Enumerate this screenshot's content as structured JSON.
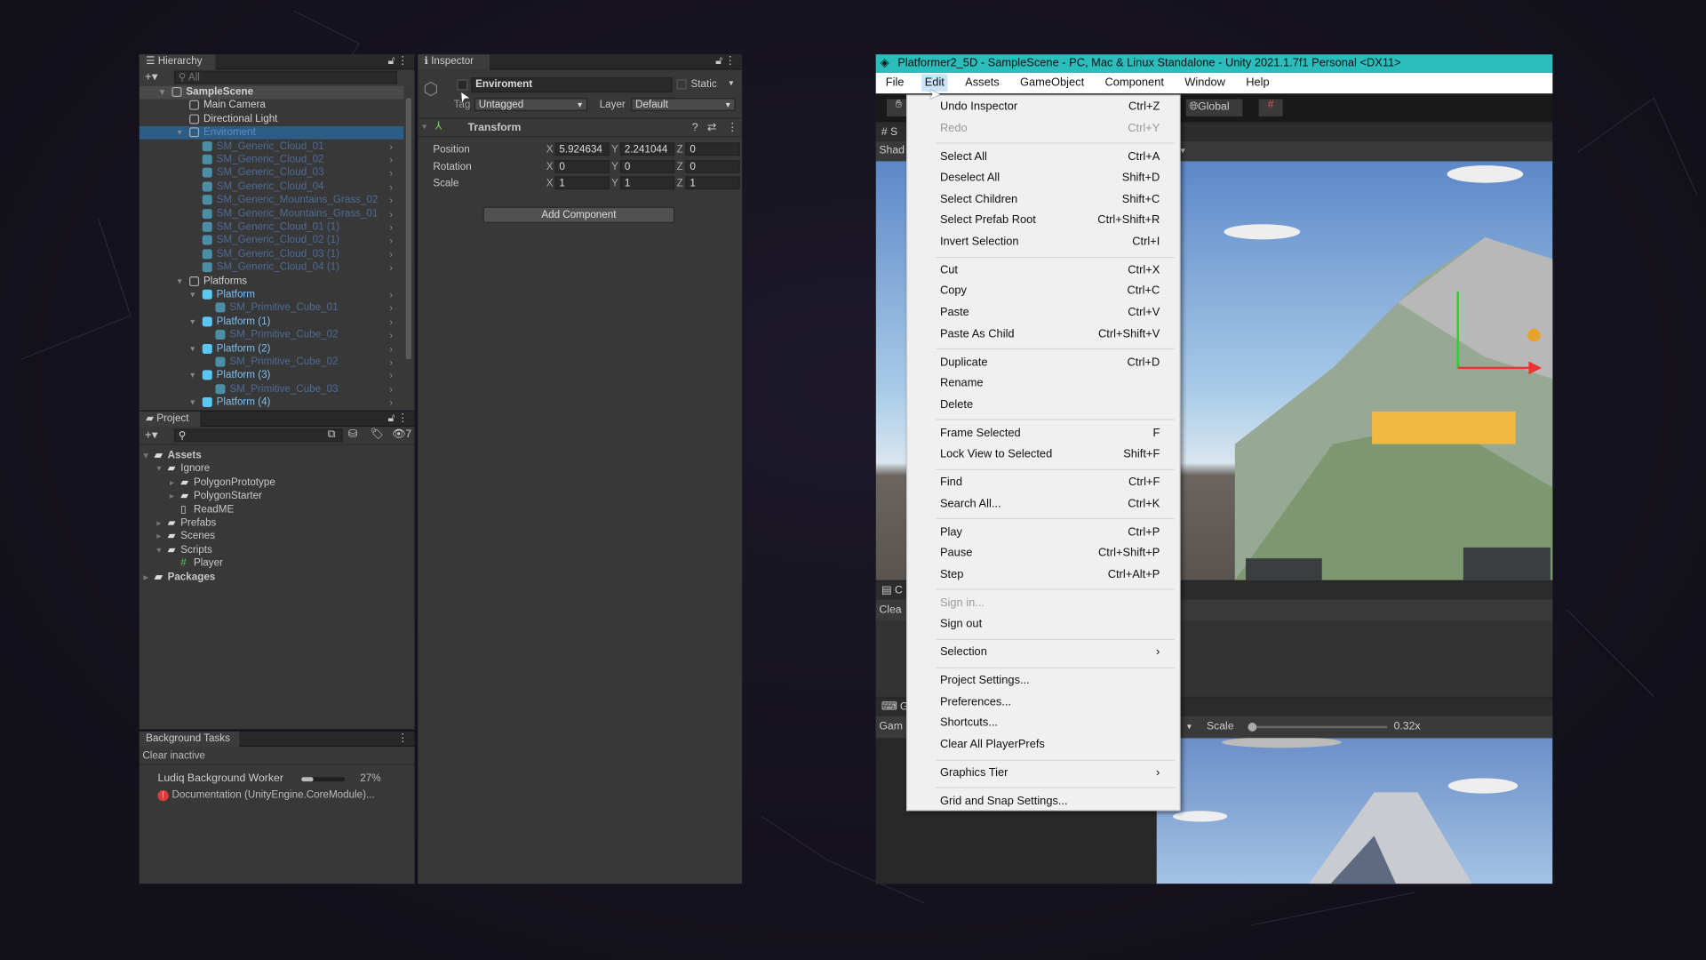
{
  "hierarchy": {
    "tab": "Hierarchy",
    "search_placeholder": "All",
    "items": [
      {
        "label": "SampleScene",
        "level": 0,
        "type": "scene"
      },
      {
        "label": "Main Camera",
        "level": 1,
        "type": "go"
      },
      {
        "label": "Directional Light",
        "level": 1,
        "type": "go"
      },
      {
        "label": "Enviroment",
        "level": 1,
        "type": "go",
        "selected": true
      },
      {
        "label": "SM_Generic_Cloud_01",
        "level": 2,
        "type": "dim"
      },
      {
        "label": "SM_Generic_Cloud_02",
        "level": 2,
        "type": "dim"
      },
      {
        "label": "SM_Generic_Cloud_03",
        "level": 2,
        "type": "dim"
      },
      {
        "label": "SM_Generic_Cloud_04",
        "level": 2,
        "type": "dim"
      },
      {
        "label": "SM_Generic_Mountains_Grass_02",
        "level": 2,
        "type": "dim"
      },
      {
        "label": "SM_Generic_Mountains_Grass_01",
        "level": 2,
        "type": "dim"
      },
      {
        "label": "SM_Generic_Cloud_01 (1)",
        "level": 2,
        "type": "dim"
      },
      {
        "label": "SM_Generic_Cloud_02 (1)",
        "level": 2,
        "type": "dim"
      },
      {
        "label": "SM_Generic_Cloud_03 (1)",
        "level": 2,
        "type": "dim"
      },
      {
        "label": "SM_Generic_Cloud_04 (1)",
        "level": 2,
        "type": "dim"
      },
      {
        "label": "Platforms",
        "level": 1,
        "type": "go"
      },
      {
        "label": "Platform",
        "level": 2,
        "type": "prefab"
      },
      {
        "label": "SM_Primitive_Cube_01",
        "level": 3,
        "type": "dim"
      },
      {
        "label": "Platform (1)",
        "level": 2,
        "type": "prefab"
      },
      {
        "label": "SM_Primitive_Cube_02",
        "level": 3,
        "type": "dim"
      },
      {
        "label": "Platform (2)",
        "level": 2,
        "type": "prefab"
      },
      {
        "label": "SM_Primitive_Cube_02",
        "level": 3,
        "type": "dim"
      },
      {
        "label": "Platform (3)",
        "level": 2,
        "type": "prefab"
      },
      {
        "label": "SM_Primitive_Cube_03",
        "level": 3,
        "type": "dim"
      },
      {
        "label": "Platform (4)",
        "level": 2,
        "type": "prefab"
      }
    ]
  },
  "inspector": {
    "tab": "Inspector",
    "object_name": "Enviroment",
    "static_label": "Static",
    "tag_label": "Tag",
    "tag_value": "Untagged",
    "layer_label": "Layer",
    "layer_value": "Default",
    "component": "Transform",
    "position": {
      "label": "Position",
      "x": "5.924634",
      "y": "2.241044",
      "z": "0"
    },
    "rotation": {
      "label": "Rotation",
      "x": "0",
      "y": "0",
      "z": "0"
    },
    "scale": {
      "label": "Scale",
      "x": "1",
      "y": "1",
      "z": "1"
    },
    "add_component": "Add Component"
  },
  "project": {
    "tab": "Project",
    "hidden_count": "7",
    "items": [
      {
        "label": "Assets",
        "level": 0,
        "kind": "folder-open"
      },
      {
        "label": "Ignore",
        "level": 1,
        "kind": "folder-open"
      },
      {
        "label": "PolygonPrototype",
        "level": 2,
        "kind": "folder"
      },
      {
        "label": "PolygonStarter",
        "level": 2,
        "kind": "folder"
      },
      {
        "label": "ReadME",
        "level": 2,
        "kind": "file"
      },
      {
        "label": "Prefabs",
        "level": 1,
        "kind": "folder"
      },
      {
        "label": "Scenes",
        "level": 1,
        "kind": "folder"
      },
      {
        "label": "Scripts",
        "level": 1,
        "kind": "folder-open"
      },
      {
        "label": "Player",
        "level": 2,
        "kind": "script"
      },
      {
        "label": "Packages",
        "level": 0,
        "kind": "folder"
      }
    ]
  },
  "tasks": {
    "tab": "Background Tasks",
    "clear": "Clear inactive",
    "worker": "Ludiq Background Worker",
    "progress": 0.27,
    "progress_text": "27%",
    "error": "Documentation (UnityEngine.CoreModule)..."
  },
  "window": {
    "title": "Platformer2_5D - SampleScene - PC, Mac & Linux Standalone - Unity 2021.1.7f1 Personal <DX11>",
    "title_color": "#2bbcbc",
    "menubar": [
      "File",
      "Edit",
      "Assets",
      "GameObject",
      "Component",
      "Window",
      "Help"
    ],
    "global": "Global",
    "scene_tab": "S",
    "shaded": "Shad",
    "console_tab": "C",
    "console_clear": "Clea",
    "game_tab": "G",
    "game_label": "Gam",
    "scale_label": "Scale",
    "scale_value": "0.32x"
  },
  "edit_menu": [
    {
      "label": "Undo Inspector",
      "shortcut": "Ctrl+Z"
    },
    {
      "label": "Redo",
      "shortcut": "Ctrl+Y",
      "disabled": true
    },
    {
      "sep": true
    },
    {
      "label": "Select All",
      "shortcut": "Ctrl+A"
    },
    {
      "label": "Deselect All",
      "shortcut": "Shift+D"
    },
    {
      "label": "Select Children",
      "shortcut": "Shift+C"
    },
    {
      "label": "Select Prefab Root",
      "shortcut": "Ctrl+Shift+R"
    },
    {
      "label": "Invert Selection",
      "shortcut": "Ctrl+I"
    },
    {
      "sep": true
    },
    {
      "label": "Cut",
      "shortcut": "Ctrl+X"
    },
    {
      "label": "Copy",
      "shortcut": "Ctrl+C"
    },
    {
      "label": "Paste",
      "shortcut": "Ctrl+V"
    },
    {
      "label": "Paste As Child",
      "shortcut": "Ctrl+Shift+V"
    },
    {
      "sep": true
    },
    {
      "label": "Duplicate",
      "shortcut": "Ctrl+D"
    },
    {
      "label": "Rename",
      "shortcut": ""
    },
    {
      "label": "Delete",
      "shortcut": ""
    },
    {
      "sep": true
    },
    {
      "label": "Frame Selected",
      "shortcut": "F"
    },
    {
      "label": "Lock View to Selected",
      "shortcut": "Shift+F"
    },
    {
      "sep": true
    },
    {
      "label": "Find",
      "shortcut": "Ctrl+F"
    },
    {
      "label": "Search All...",
      "shortcut": "Ctrl+K"
    },
    {
      "sep": true
    },
    {
      "label": "Play",
      "shortcut": "Ctrl+P"
    },
    {
      "label": "Pause",
      "shortcut": "Ctrl+Shift+P"
    },
    {
      "label": "Step",
      "shortcut": "Ctrl+Alt+P"
    },
    {
      "sep": true
    },
    {
      "label": "Sign in...",
      "shortcut": "",
      "disabled": true
    },
    {
      "label": "Sign out",
      "shortcut": ""
    },
    {
      "sep": true
    },
    {
      "label": "Selection",
      "shortcut": "›"
    },
    {
      "sep": true
    },
    {
      "label": "Project Settings...",
      "shortcut": ""
    },
    {
      "label": "Preferences...",
      "shortcut": ""
    },
    {
      "label": "Shortcuts...",
      "shortcut": ""
    },
    {
      "label": "Clear All PlayerPrefs",
      "shortcut": ""
    },
    {
      "sep": true
    },
    {
      "label": "Graphics Tier",
      "shortcut": "›"
    },
    {
      "sep": true
    },
    {
      "label": "Grid and Snap Settings...",
      "shortcut": ""
    }
  ]
}
